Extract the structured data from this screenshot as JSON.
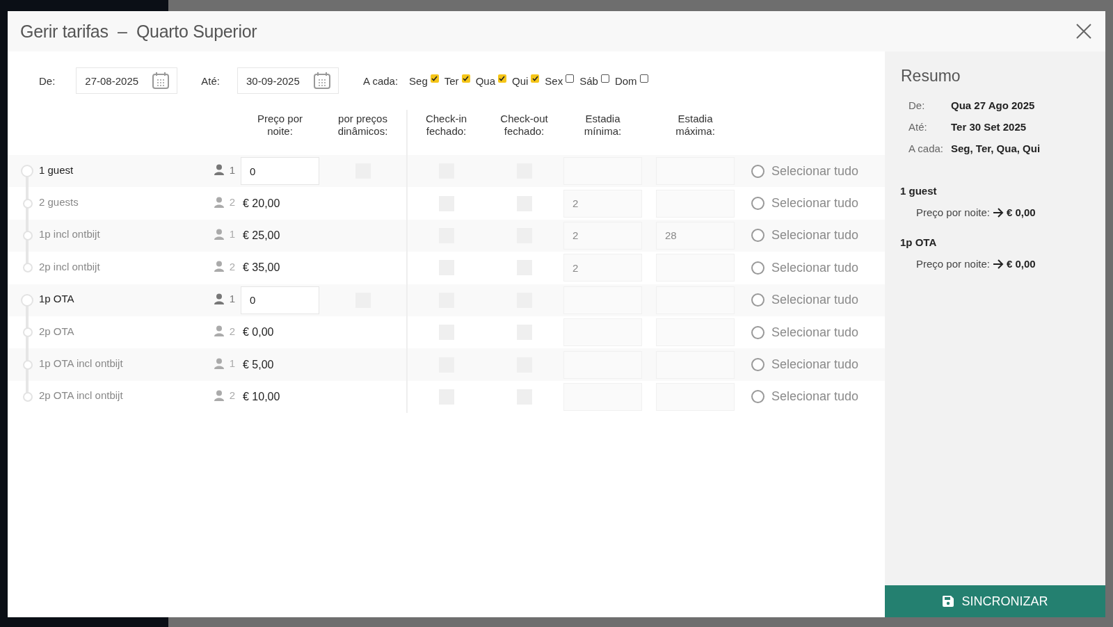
{
  "dialog": {
    "title": "Gerir tarifas",
    "separator": "–",
    "subtitle": "Quarto Superior"
  },
  "filters": {
    "from_label": "De:",
    "from": "27-08-2025",
    "to_label": "Até:",
    "to": "30-09-2025",
    "days_label": "A cada:",
    "days": [
      {
        "label": "Seg",
        "checked": true
      },
      {
        "label": "Ter",
        "checked": true
      },
      {
        "label": "Qua",
        "checked": true
      },
      {
        "label": "Qui",
        "checked": true
      },
      {
        "label": "Sex",
        "checked": false
      },
      {
        "label": "Sáb",
        "checked": false
      },
      {
        "label": "Dom",
        "checked": false
      }
    ]
  },
  "columns": [
    "Preço por noite:",
    "por preços dinâmicos:",
    "Check-in fechado:",
    "Check-out fechado:",
    "Estadia mínima:",
    "Estadia máxima:"
  ],
  "rate_groups": [
    {
      "name": "1 guest",
      "guests": "1",
      "price": "0",
      "dynamic": false,
      "checkin_closed": false,
      "checkout_closed": false,
      "select_all": "Selecionar tudo",
      "select_all_checked": false,
      "children": [
        {
          "name": "2 guests",
          "guests": "2",
          "price": "€ 20,00",
          "checkin_closed": false,
          "checkout_closed": false,
          "min_stay": "2",
          "select_all": "Selecionar tudo",
          "select_all_checked": false
        },
        {
          "name": "1p incl ontbijt",
          "guests": "1",
          "price": "€ 25,00",
          "checkin_closed": false,
          "checkout_closed": false,
          "min_stay": "2",
          "max_stay": "28",
          "select_all": "Selecionar tudo",
          "select_all_checked": false
        },
        {
          "name": "2p incl ontbijt",
          "guests": "2",
          "price": "€ 35,00",
          "checkin_closed": false,
          "checkout_closed": false,
          "min_stay": "2",
          "select_all": "Selecionar tudo",
          "select_all_checked": false
        }
      ]
    },
    {
      "name": "1p OTA",
      "guests": "1",
      "price": "0",
      "dynamic": false,
      "checkin_closed": false,
      "checkout_closed": false,
      "select_all": "Selecionar tudo",
      "select_all_checked": false,
      "children": [
        {
          "name": "2p OTA",
          "guests": "2",
          "price": "€ 0,00",
          "checkin_closed": false,
          "checkout_closed": false,
          "select_all": "Selecionar tudo",
          "select_all_checked": false
        },
        {
          "name": "1p OTA incl ontbijt",
          "guests": "1",
          "price": "€ 5,00",
          "checkin_closed": false,
          "checkout_closed": false,
          "select_all": "Selecionar tudo",
          "select_all_checked": false
        },
        {
          "name": "2p OTA incl ontbijt",
          "guests": "2",
          "price": "€ 10,00",
          "checkin_closed": false,
          "checkout_closed": false,
          "select_all": "Selecionar tudo",
          "select_all_checked": false
        }
      ]
    }
  ],
  "summary": {
    "title": "Resumo",
    "fields": [
      {
        "label": "De:",
        "value": "Qua 27 Ago 2025"
      },
      {
        "label": "Até:",
        "value": "Ter 30 Set 2025"
      },
      {
        "label": "A cada:",
        "value": "Seg, Ter, Qua, Qui"
      }
    ],
    "rates": [
      {
        "name": "1 guest",
        "label": "Preço por noite:",
        "value": "€ 0,00"
      },
      {
        "name": "1p OTA",
        "label": "Preço por noite:",
        "value": "€ 0,00"
      }
    ]
  },
  "sync_button": "SINCRONIZAR"
}
